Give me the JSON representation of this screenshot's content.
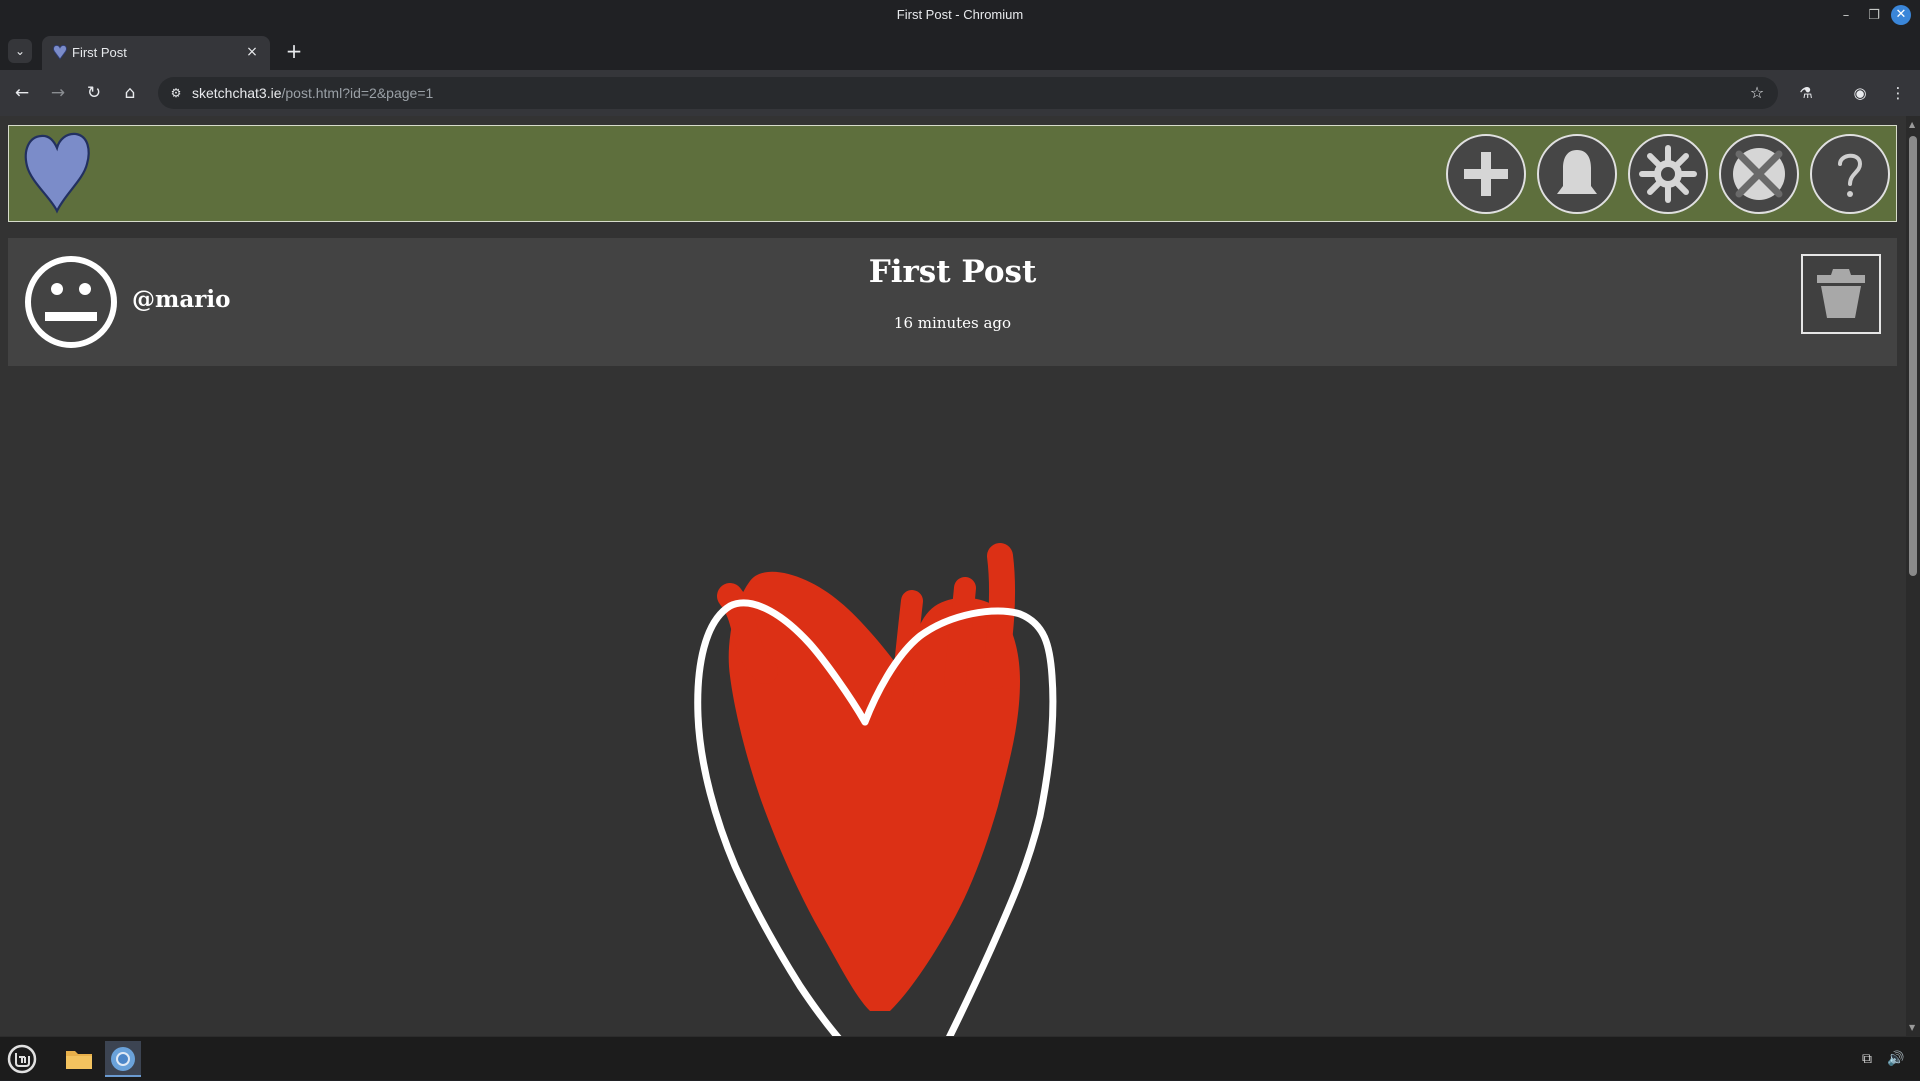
{
  "window": {
    "title": "First Post - Chromium",
    "minimize_glyph": "–",
    "restore_glyph": "❐",
    "close_glyph": "✕"
  },
  "tabs": [
    {
      "title": "First Post",
      "icon": "heart-favicon-icon",
      "active": true
    }
  ],
  "toolbar": {
    "url_domain": "sketchchat3.ie",
    "url_path": "/post.html?id=2&page=1",
    "back_glyph": "←",
    "forward_glyph": "→",
    "reload_glyph": "↻",
    "home_glyph": "⌂",
    "star_glyph": "☆",
    "labs_glyph": "⚗",
    "profile_glyph": "◉",
    "menu_glyph": "⋮",
    "newtab_glyph": "+",
    "tablist_glyph": "⌄",
    "tab_close_glyph": "×",
    "site_info_glyph": "⚙"
  },
  "header": {
    "logo_icon": "heart-logo-icon",
    "logo_color": "#7b8cc9",
    "background_color": "#5e6f3d",
    "buttons": [
      {
        "name": "new-post-button",
        "icon": "plus-icon"
      },
      {
        "name": "notifications-button",
        "icon": "bell-icon"
      },
      {
        "name": "settings-button",
        "icon": "gear-icon"
      },
      {
        "name": "logout-button",
        "icon": "cross-circle-icon"
      },
      {
        "name": "help-button",
        "icon": "question-icon"
      }
    ]
  },
  "post": {
    "username": "@mario",
    "avatar_icon": "neutral-face-icon",
    "title": "First Post",
    "time": "16 minutes ago",
    "delete_icon": "trash-icon",
    "drawing": {
      "description_icon": "red-heart-sketch-icon",
      "fill_color": "#dc3015",
      "outline_color": "#ffffff",
      "background_color": "#333333"
    }
  },
  "taskbar": {
    "items": [
      {
        "name": "mint-menu",
        "icon": "mint-logo-icon"
      },
      {
        "name": "files",
        "icon": "folder-icon"
      },
      {
        "name": "chromium",
        "icon": "chromium-icon",
        "active": true
      }
    ],
    "tray": [
      {
        "name": "network",
        "icon": "network-icon",
        "glyph": "⧉"
      },
      {
        "name": "volume",
        "icon": "volume-icon",
        "glyph": "🔊"
      }
    ]
  }
}
